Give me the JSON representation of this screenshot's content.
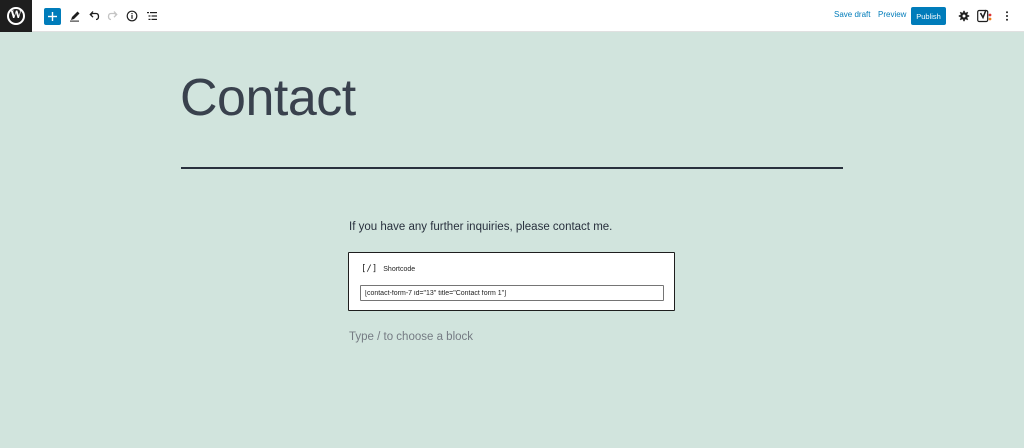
{
  "toolbar": {
    "add_label": "+",
    "save_draft": "Save draft",
    "preview": "Preview",
    "publish": "Publish",
    "icons": [
      "wordpress-icon",
      "plus-icon",
      "pencil-icon",
      "undo-icon",
      "redo-icon",
      "info-icon",
      "list-view-icon",
      "gear-icon",
      "yoast-icon",
      "more-vertical-icon"
    ]
  },
  "editor": {
    "title": "Contact",
    "paragraph": "If you have any further inquiries, please contact me.",
    "shortcode": {
      "icon_text": "[/]",
      "label": "Shortcode",
      "value": "[contact-form-7 id=\"13\" title=\"Contact form 1\"]"
    },
    "placeholder": "Type / to choose a block"
  },
  "colors": {
    "background": "#d1e4dd",
    "accent": "#007cba",
    "text": "#28303d"
  }
}
